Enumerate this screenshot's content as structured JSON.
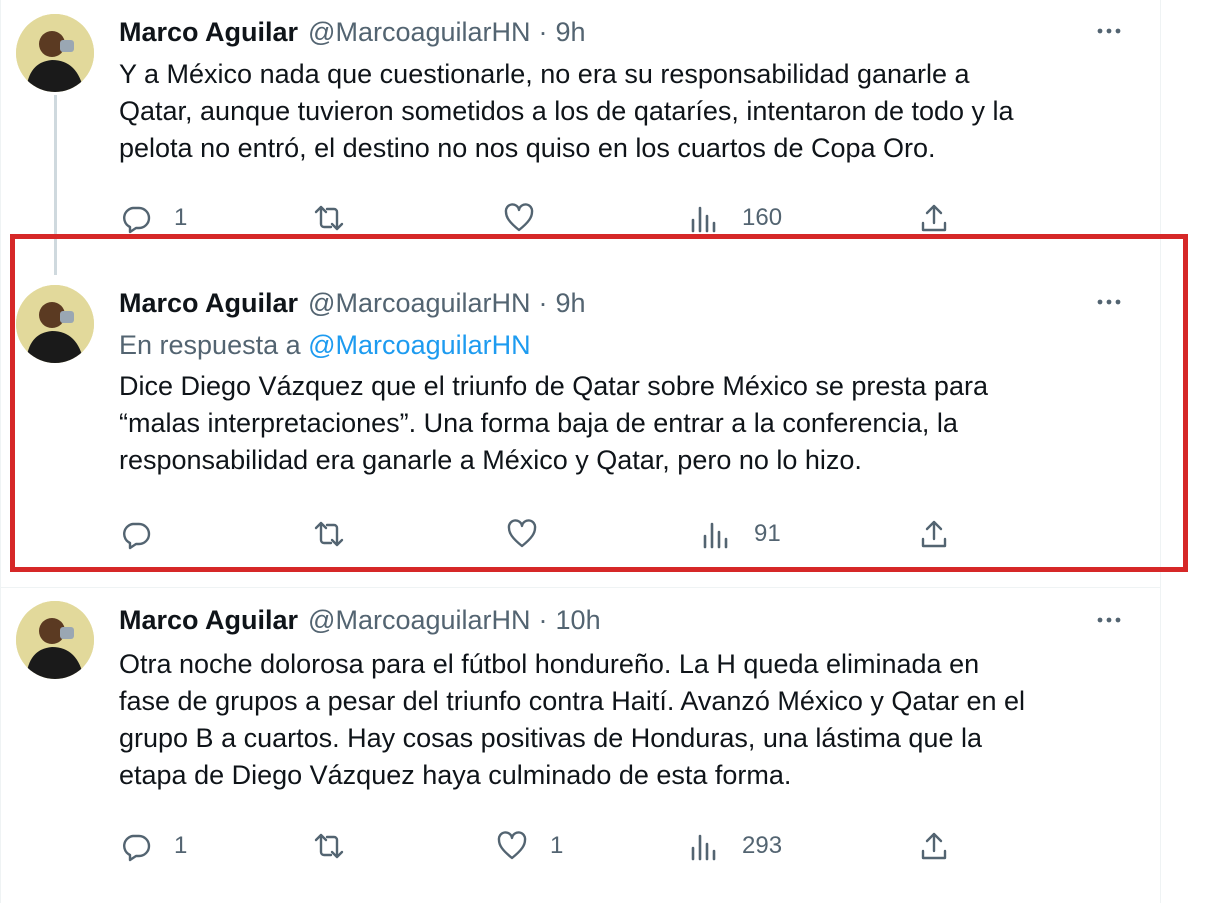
{
  "tweets": [
    {
      "name": "Marco Aguilar",
      "handle": "@MarcoaguilarHN",
      "dot": "·",
      "time": "9h",
      "reply_prefix": "",
      "reply_to": "",
      "text_lines": [
        "Y a México nada que cuestionarle, no era su responsabilidad ganarle a",
        "Qatar, aunque tuvieron sometidos a los de qataríes, intentaron de todo y la",
        "pelota no entró, el destino no nos quiso en los cuartos de Copa Oro."
      ],
      "replies": "1",
      "retweets": "",
      "likes": "",
      "views": "160"
    },
    {
      "name": "Marco Aguilar",
      "handle": "@MarcoaguilarHN",
      "dot": "·",
      "time": "9h",
      "reply_prefix": "En respuesta a",
      "reply_to": "@MarcoaguilarHN",
      "text_lines": [
        "Dice Diego Vázquez que el triunfo de Qatar sobre México se presta para",
        "“malas interpretaciones”. Una forma baja de entrar a la conferencia, la",
        "responsabilidad era ganarle a México y Qatar, pero no lo hizo."
      ],
      "replies": "",
      "retweets": "",
      "likes": "",
      "views": "91"
    },
    {
      "name": "Marco Aguilar",
      "handle": "@MarcoaguilarHN",
      "dot": "·",
      "time": "10h",
      "reply_prefix": "",
      "reply_to": "",
      "text_lines": [
        "Otra noche dolorosa para el fútbol hondureño. La H queda eliminada en",
        "fase de grupos a pesar del triunfo contra Haití. Avanzó México y Qatar en el",
        "grupo B a cuartos. Hay cosas positivas de Honduras, una lástima que la",
        "etapa de Diego Vázquez haya culminado de esta forma."
      ],
      "replies": "1",
      "retweets": "",
      "likes": "1",
      "views": "293"
    }
  ],
  "icons": {
    "reply": "reply-icon",
    "retweet": "retweet-icon",
    "like": "heart-icon",
    "views": "views-icon",
    "share": "share-icon",
    "more": "more-icon"
  },
  "colors": {
    "link": "#1d9bf0",
    "secondary_text": "#536471",
    "highlight_border": "#d62828"
  }
}
